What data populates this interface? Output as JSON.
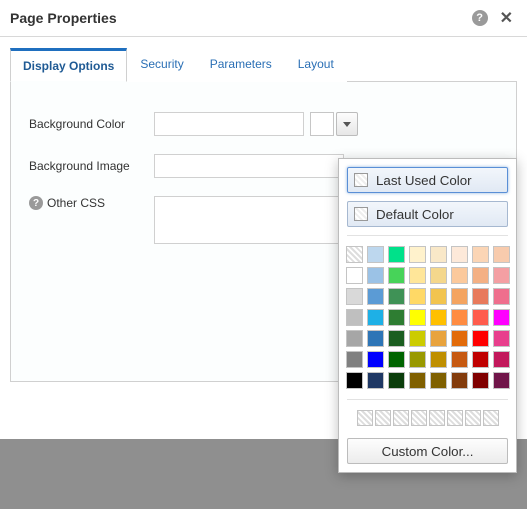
{
  "dialog": {
    "title": "Page Properties"
  },
  "tabs": {
    "display_options": "Display Options",
    "security": "Security",
    "parameters": "Parameters",
    "layout": "Layout"
  },
  "form": {
    "bg_color_label": "Background Color",
    "bg_color_value": "",
    "bg_image_label": "Background Image",
    "bg_image_value": "",
    "other_css_label": "Other CSS",
    "other_css_value": ""
  },
  "color_picker": {
    "last_used": "Last Used Color",
    "default": "Default Color",
    "custom": "Custom Color...",
    "colors_row1": [
      "none",
      "#BDD7EE",
      "#00E18A",
      "#FFF2CC",
      "#F9E8C8",
      "#FDE9D9",
      "#FBD5B5",
      "#F8CBAD"
    ],
    "colors_row2": [
      "#FFFFFF",
      "#9BC2E6",
      "#47D359",
      "#FFE699",
      "#F4D78C",
      "#FBC99C",
      "#F4B084",
      "#F49FA3"
    ],
    "colors_row3": [
      "#D9D9D9",
      "#5B9BD5",
      "#3F9256",
      "#FFD966",
      "#F2C44F",
      "#F4A460",
      "#E87A5C",
      "#EF6F8D"
    ],
    "colors_row4": [
      "#BFBFBF",
      "#1EB0E6",
      "#2E7D32",
      "#FFFF00",
      "#FFC000",
      "#FF8C42",
      "#FF5C4D",
      "#FF00FF"
    ],
    "colors_row5": [
      "#A6A6A6",
      "#2E75B6",
      "#1B5E20",
      "#CCCC00",
      "#E8A33D",
      "#E26B0A",
      "#FF0000",
      "#E83E8C"
    ],
    "colors_row6": [
      "#808080",
      "#0000FF",
      "#006400",
      "#999900",
      "#BF8F00",
      "#C65911",
      "#C00000",
      "#C2185B"
    ],
    "colors_row7": [
      "#000000",
      "#1F3864",
      "#0B3D0B",
      "#806000",
      "#7F6000",
      "#833C0C",
      "#800000",
      "#701549"
    ],
    "recent": [
      "none",
      "none",
      "none",
      "none",
      "none",
      "none",
      "none",
      "none"
    ]
  }
}
